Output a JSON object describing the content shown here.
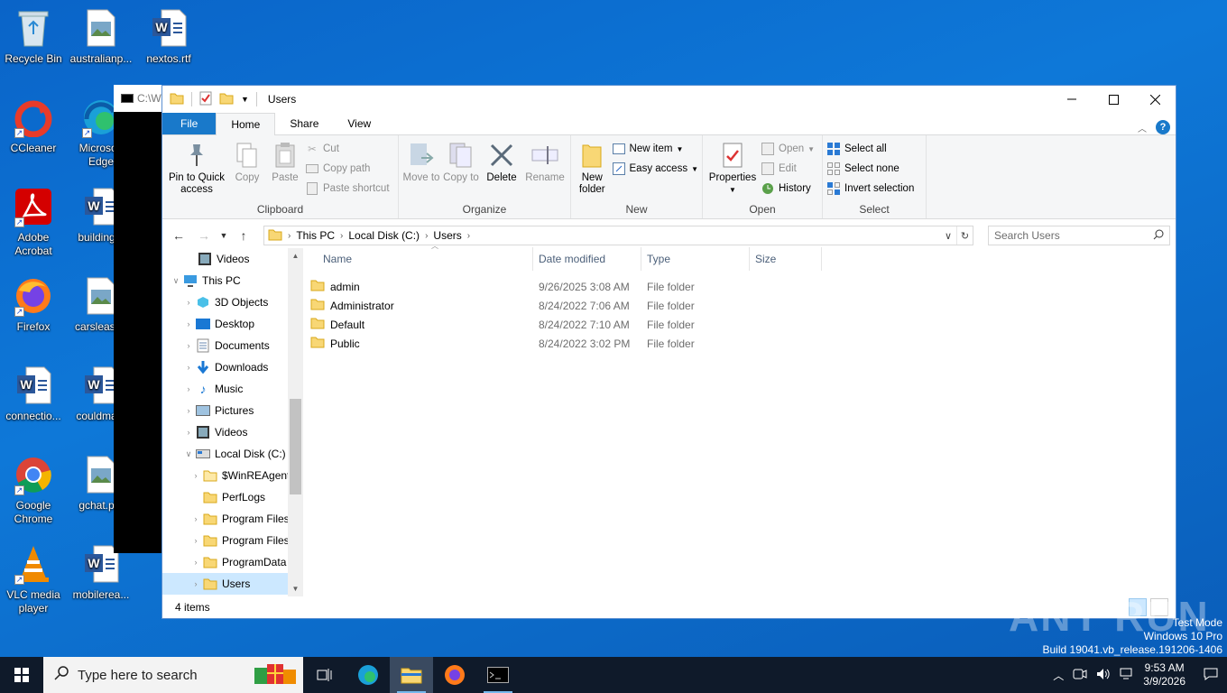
{
  "desktop": {
    "icons": [
      {
        "label": "Recycle Bin"
      },
      {
        "label": "australianp..."
      },
      {
        "label": "nextos.rtf"
      },
      {
        "label": "CCleaner"
      },
      {
        "label": "Microsoft Edge"
      },
      {
        "label": "Adobe Acrobat"
      },
      {
        "label": "building..."
      },
      {
        "label": "Firefox"
      },
      {
        "label": "carsleast..."
      },
      {
        "label": "connectio..."
      },
      {
        "label": "couldma..."
      },
      {
        "label": "Google Chrome"
      },
      {
        "label": "gchat.p..."
      },
      {
        "label": "VLC media player"
      },
      {
        "label": "mobilerea..."
      }
    ]
  },
  "console": {
    "title": "C:\\W"
  },
  "explorer": {
    "title": "Users",
    "tabs": {
      "file": "File",
      "home": "Home",
      "share": "Share",
      "view": "View"
    },
    "ribbon": {
      "clipboard": {
        "label": "Clipboard",
        "pin": "Pin to Quick access",
        "copy": "Copy",
        "paste": "Paste",
        "cut": "Cut",
        "copy_path": "Copy path",
        "paste_shortcut": "Paste shortcut"
      },
      "organize": {
        "label": "Organize",
        "move_to": "Move to",
        "copy_to": "Copy to",
        "delete": "Delete",
        "rename": "Rename"
      },
      "new": {
        "label": "New",
        "new_folder": "New folder",
        "new_item": "New item",
        "easy_access": "Easy access"
      },
      "open": {
        "label": "Open",
        "properties": "Properties",
        "open": "Open",
        "edit": "Edit",
        "history": "History"
      },
      "select": {
        "label": "Select",
        "select_all": "Select all",
        "select_none": "Select none",
        "invert": "Invert selection"
      }
    },
    "address": {
      "crumbs": [
        "This PC",
        "Local Disk (C:)",
        "Users"
      ],
      "search_placeholder": "Search Users"
    },
    "nav": [
      {
        "label": "Videos"
      },
      {
        "label": "This PC"
      },
      {
        "label": "3D Objects"
      },
      {
        "label": "Desktop"
      },
      {
        "label": "Documents"
      },
      {
        "label": "Downloads"
      },
      {
        "label": "Music"
      },
      {
        "label": "Pictures"
      },
      {
        "label": "Videos"
      },
      {
        "label": "Local Disk (C:)"
      },
      {
        "label": "$WinREAgent"
      },
      {
        "label": "PerfLogs"
      },
      {
        "label": "Program Files"
      },
      {
        "label": "Program Files"
      },
      {
        "label": "ProgramData"
      },
      {
        "label": "Users"
      }
    ],
    "columns": {
      "name": "Name",
      "date": "Date modified",
      "type": "Type",
      "size": "Size"
    },
    "files": [
      {
        "name": "admin",
        "date": "9/26/2025 3:08 AM",
        "type": "File folder"
      },
      {
        "name": "Administrator",
        "date": "8/24/2022 7:06 AM",
        "type": "File folder"
      },
      {
        "name": "Default",
        "date": "8/24/2022 7:10 AM",
        "type": "File folder"
      },
      {
        "name": "Public",
        "date": "8/24/2022 3:02 PM",
        "type": "File folder"
      }
    ],
    "status": "4 items"
  },
  "watermark": {
    "line1": "Test Mode",
    "line2": "Windows 10 Pro",
    "line3": "Build 19041.vb_release.191206-1406",
    "brand": "ANY RUN"
  },
  "taskbar": {
    "search_placeholder": "Type here to search",
    "time": "9:53 AM",
    "date": "3/9/2026"
  }
}
